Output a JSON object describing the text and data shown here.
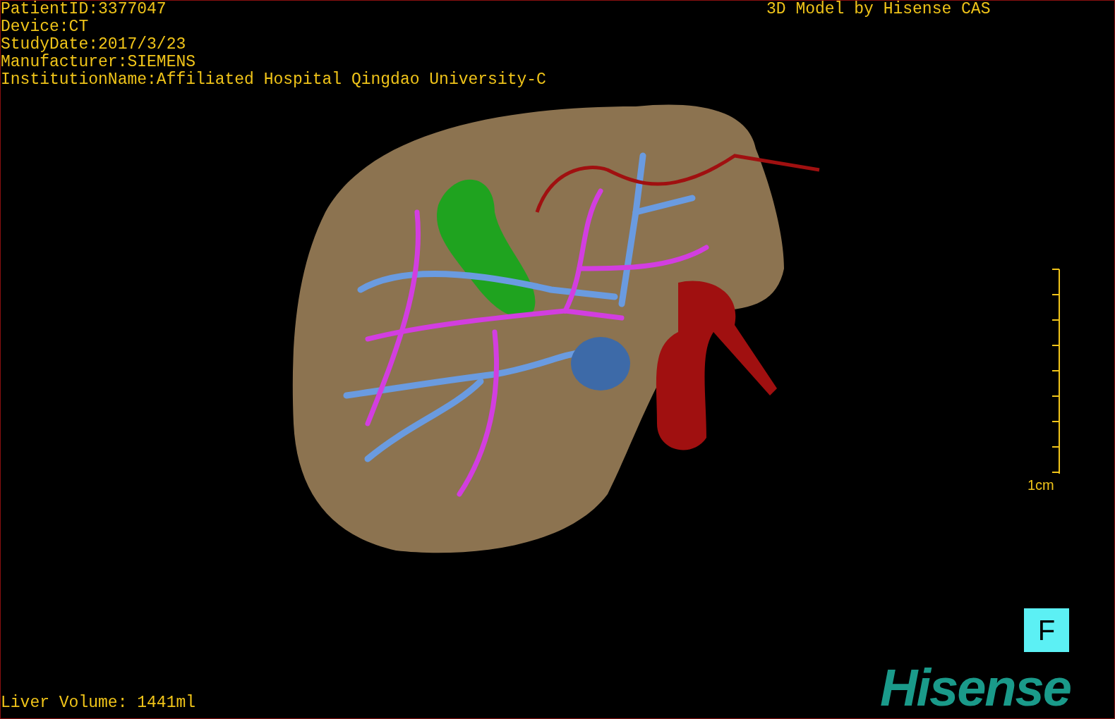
{
  "patient_info": [
    "PatientID:3377047",
    "Device:CT",
    "StudyDate:2017/3/23",
    "Manufacturer:SIEMENS",
    "InstitutionName:Affiliated Hospital Qingdao University-C"
  ],
  "header_right": "3D Model by Hisense CAS",
  "scale_bar": {
    "label": "1cm"
  },
  "orientation_button": {
    "label": "F"
  },
  "logo": "Hisense",
  "volume": "Liver Volume: 1441ml"
}
